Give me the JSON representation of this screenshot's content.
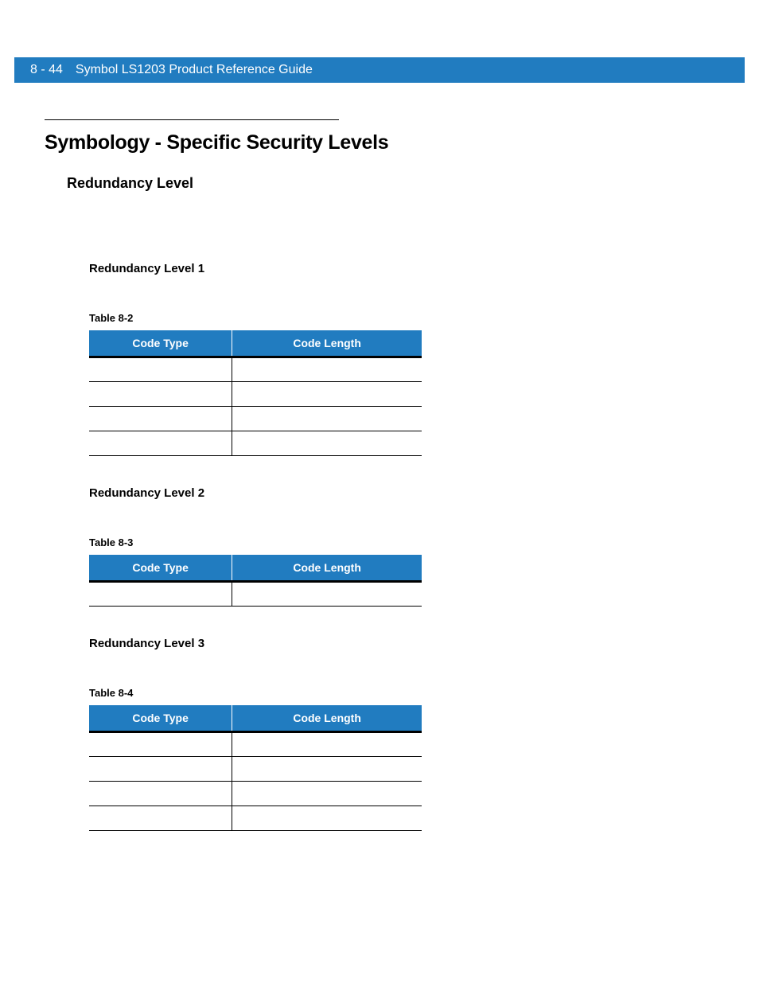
{
  "header": {
    "page_number": "8 - 44",
    "doc_title": "Symbol LS1203 Product Reference Guide"
  },
  "section_title": "Symbology - Specific Security Levels",
  "subsection_title": "Redundancy Level",
  "levels": [
    {
      "title": "Redundancy Level 1",
      "table_caption": "Table 8-2",
      "columns": [
        "Code Type",
        "Code Length"
      ],
      "rows": [
        {
          "code_type": "",
          "code_length": ""
        },
        {
          "code_type": "",
          "code_length": ""
        },
        {
          "code_type": "",
          "code_length": ""
        },
        {
          "code_type": "",
          "code_length": ""
        }
      ]
    },
    {
      "title": "Redundancy Level 2",
      "table_caption": "Table 8-3",
      "columns": [
        "Code Type",
        "Code Length"
      ],
      "rows": [
        {
          "code_type": "",
          "code_length": ""
        }
      ]
    },
    {
      "title": "Redundancy Level 3",
      "table_caption": "Table 8-4",
      "columns": [
        "Code Type",
        "Code Length"
      ],
      "rows": [
        {
          "code_type": "",
          "code_length": ""
        },
        {
          "code_type": "",
          "code_length": ""
        },
        {
          "code_type": "",
          "code_length": ""
        },
        {
          "code_type": "",
          "code_length": ""
        }
      ]
    }
  ]
}
